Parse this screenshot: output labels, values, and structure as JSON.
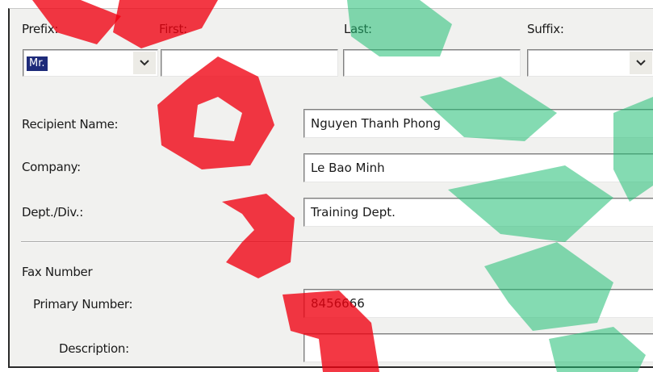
{
  "name_row": {
    "prefix_label": "Prefix:",
    "first_label": "First:",
    "last_label": "Last:",
    "suffix_label": "Suffix:",
    "prefix_value": "Mr.",
    "first_value": "",
    "last_value": "",
    "suffix_value": ""
  },
  "recipient": {
    "name_label": "Recipient Name:",
    "name_value": "Nguyen Thanh Phong",
    "company_label": "Company:",
    "company_value": "Le Bao Minh",
    "dept_label": "Dept./Div.:",
    "dept_value": "Training Dept."
  },
  "fax": {
    "section_label": "Fax Number",
    "primary_label": "Primary Number:",
    "primary_value": "8456666",
    "description_label": "Description:",
    "description_value": ""
  },
  "icons": {
    "dropdown": "chevron-down-icon"
  },
  "colors": {
    "selection": "#1e2b7a",
    "watermark_red": "#f0000f",
    "watermark_green": "#1fbe73"
  }
}
